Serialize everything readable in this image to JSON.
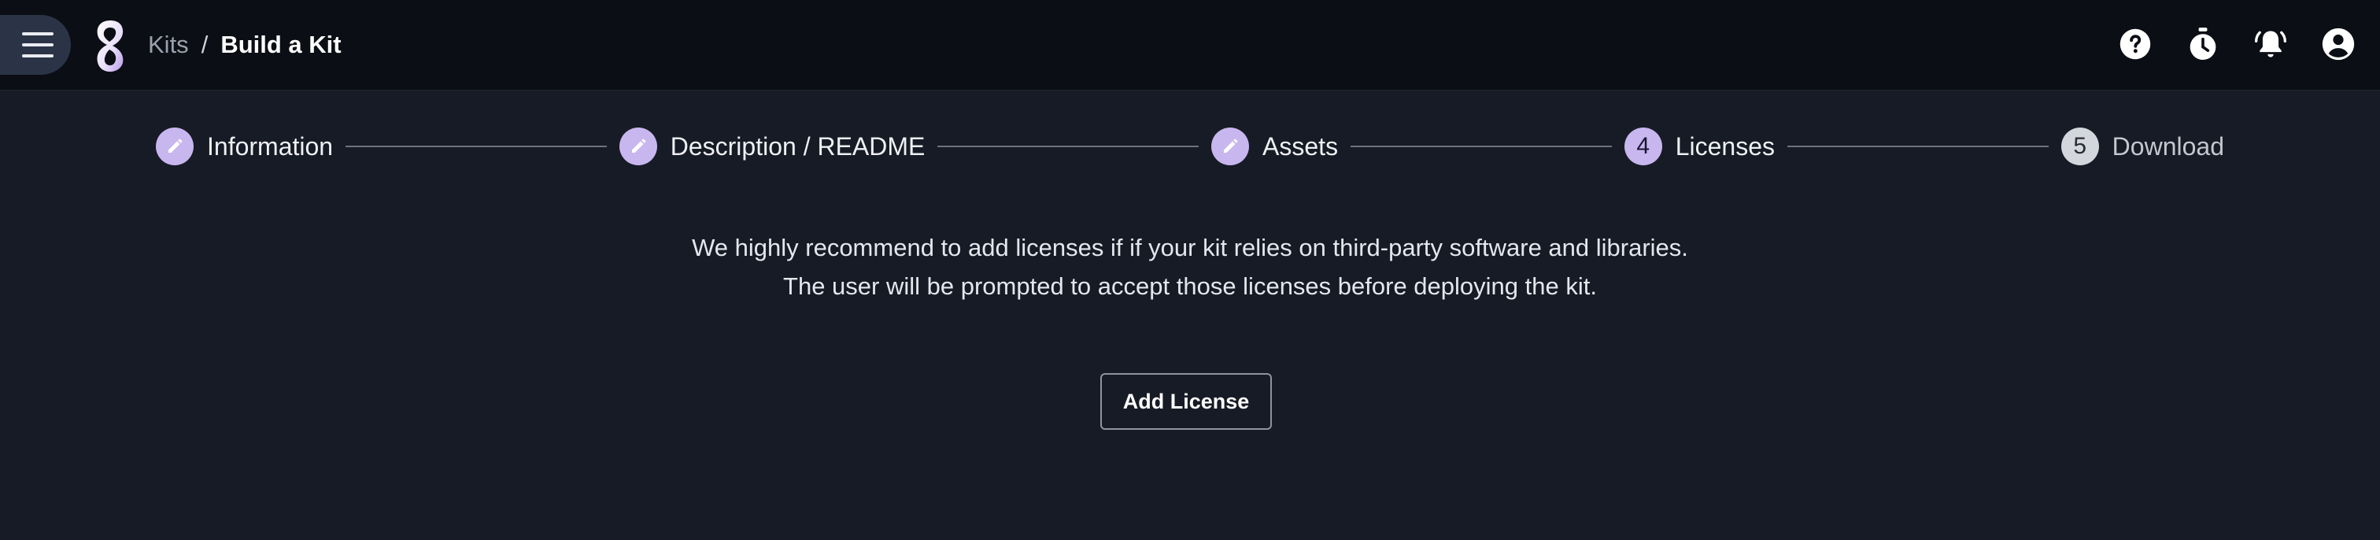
{
  "header": {
    "menu_icon": "hamburger-menu-icon",
    "logo_icon": "app-logo",
    "breadcrumb": {
      "parent": "Kits",
      "separator": "/",
      "current": "Build a Kit"
    },
    "actions": [
      {
        "icon": "help-icon"
      },
      {
        "icon": "timer-icon"
      },
      {
        "icon": "notifications-icon"
      },
      {
        "icon": "account-icon"
      }
    ]
  },
  "stepper": {
    "steps": [
      {
        "label": "Information",
        "state": "completed",
        "icon": "pencil-icon"
      },
      {
        "label": "Description / README",
        "state": "completed",
        "icon": "pencil-icon"
      },
      {
        "label": "Assets",
        "state": "completed",
        "icon": "pencil-icon"
      },
      {
        "label": "Licenses",
        "state": "active",
        "number": "4"
      },
      {
        "label": "Download",
        "state": "pending",
        "number": "5"
      }
    ]
  },
  "main": {
    "message_line1": "We highly recommend to add licenses if if your kit relies on third-party software and libraries.",
    "message_line2": "The user will be prompted to accept those licenses before deploying the kit.",
    "add_license_label": "Add License"
  },
  "colors": {
    "background": "#171b25",
    "topbar": "#0b0e14",
    "step_accent": "#c8b6ef",
    "step_pending": "#d3d6dc"
  }
}
